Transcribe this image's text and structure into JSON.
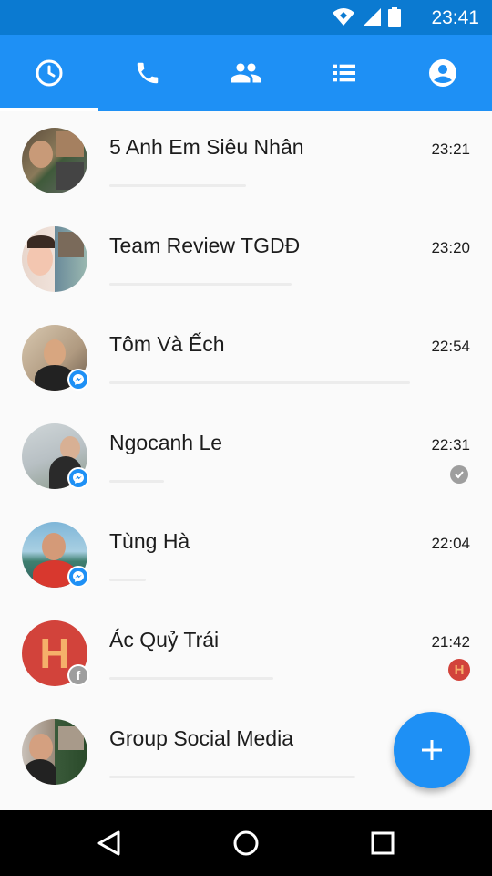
{
  "status_bar": {
    "time": "23:41"
  },
  "tabs": [
    {
      "icon": "clock-icon",
      "active": true
    },
    {
      "icon": "phone-icon",
      "active": false
    },
    {
      "icon": "people-icon",
      "active": false
    },
    {
      "icon": "list-icon",
      "active": false
    },
    {
      "icon": "account-icon",
      "active": false
    }
  ],
  "conversations": [
    {
      "name": "5 Anh Em Siêu Nhân",
      "time": "23:21",
      "badge": "none",
      "status": "none"
    },
    {
      "name": "Team Review TGDĐ",
      "time": "23:20",
      "badge": "none",
      "status": "none"
    },
    {
      "name": "Tôm Và Ếch",
      "time": "22:54",
      "badge": "messenger",
      "status": "none"
    },
    {
      "name": "Ngocanh Le",
      "time": "22:31",
      "badge": "messenger",
      "status": "sent-check"
    },
    {
      "name": "Tùng Hà",
      "time": "22:04",
      "badge": "messenger",
      "status": "none"
    },
    {
      "name": "Ác Quỷ Trái",
      "time": "21:42",
      "badge": "facebook",
      "status": "seen-avatar",
      "avatar_letter": "H",
      "seen_letter": "H"
    },
    {
      "name": "Group Social Media",
      "time": "",
      "badge": "none",
      "status": "none"
    }
  ],
  "fab": {
    "icon": "plus-icon"
  },
  "colors": {
    "accent": "#1e90f5",
    "status_bar": "#0b7ad1"
  }
}
